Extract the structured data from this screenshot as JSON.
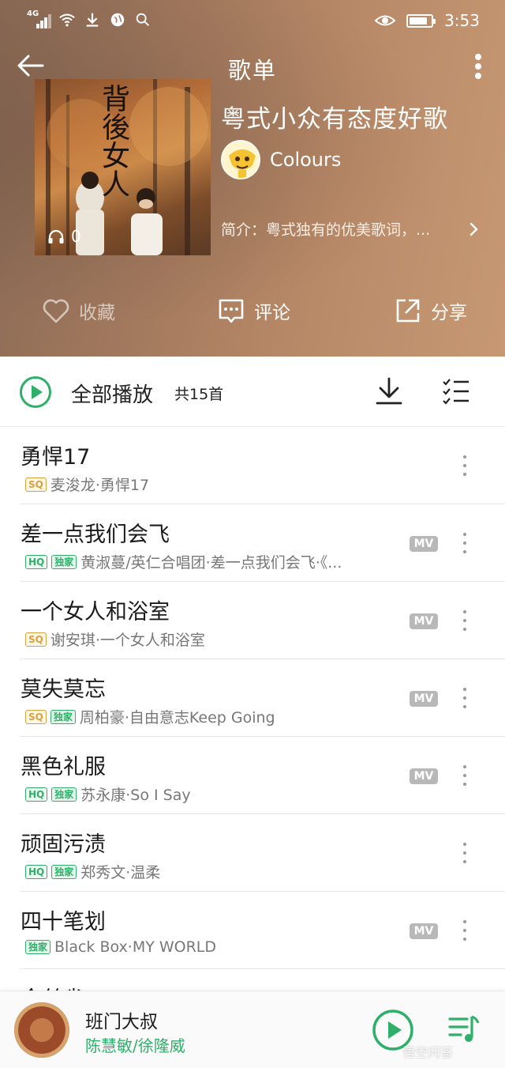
{
  "status_bar": {
    "network": "4G",
    "time": "3:53"
  },
  "nav": {
    "title": "歌单"
  },
  "playlist": {
    "title": "粤式小众有态度好歌",
    "cover_text": "背後女人",
    "play_count": "0",
    "creator_name": "Colours",
    "intro": "简介：粤式独有的优美歌词，..."
  },
  "actions": {
    "favorite": "收藏",
    "comment": "评论",
    "share": "分享"
  },
  "play_all": {
    "label": "全部播放",
    "count": "共15首"
  },
  "songs": [
    {
      "title": "勇悍17",
      "badges": [
        "SQ"
      ],
      "sub": "麦浚龙·勇悍17",
      "mv": false
    },
    {
      "title": "差一点我们会飞",
      "badges": [
        "HQ",
        "独家"
      ],
      "sub": "黄淑蔓/英仁合唱团·差一点我们会飞·《...",
      "mv": true
    },
    {
      "title": "一个女人和浴室",
      "badges": [
        "SQ"
      ],
      "sub": "谢安琪·一个女人和浴室",
      "mv": true
    },
    {
      "title": "莫失莫忘",
      "badges": [
        "SQ",
        "独家"
      ],
      "sub": "周柏豪·自由意志Keep Going",
      "mv": true
    },
    {
      "title": "黑色礼服",
      "badges": [
        "HQ",
        "独家"
      ],
      "sub": "苏永康·So I Say",
      "mv": true
    },
    {
      "title": "顽固污渍",
      "badges": [
        "HQ",
        "独家"
      ],
      "sub": "郑秀文·温柔",
      "mv": false
    },
    {
      "title": "四十笔划",
      "badges": [
        "独家"
      ],
      "sub": "Black Box·MY WORLD",
      "mv": true
    },
    {
      "title": "金丝雀",
      "badges": [],
      "sub": "",
      "mv": false
    }
  ],
  "mv_label": "MV",
  "mini_player": {
    "title": "班门大叔",
    "artist": "陈慧敏/徐隆威",
    "watermark": "悟空问答"
  },
  "colors": {
    "accent_green": "#2fb06a",
    "header_brown": "#a47a5e"
  }
}
